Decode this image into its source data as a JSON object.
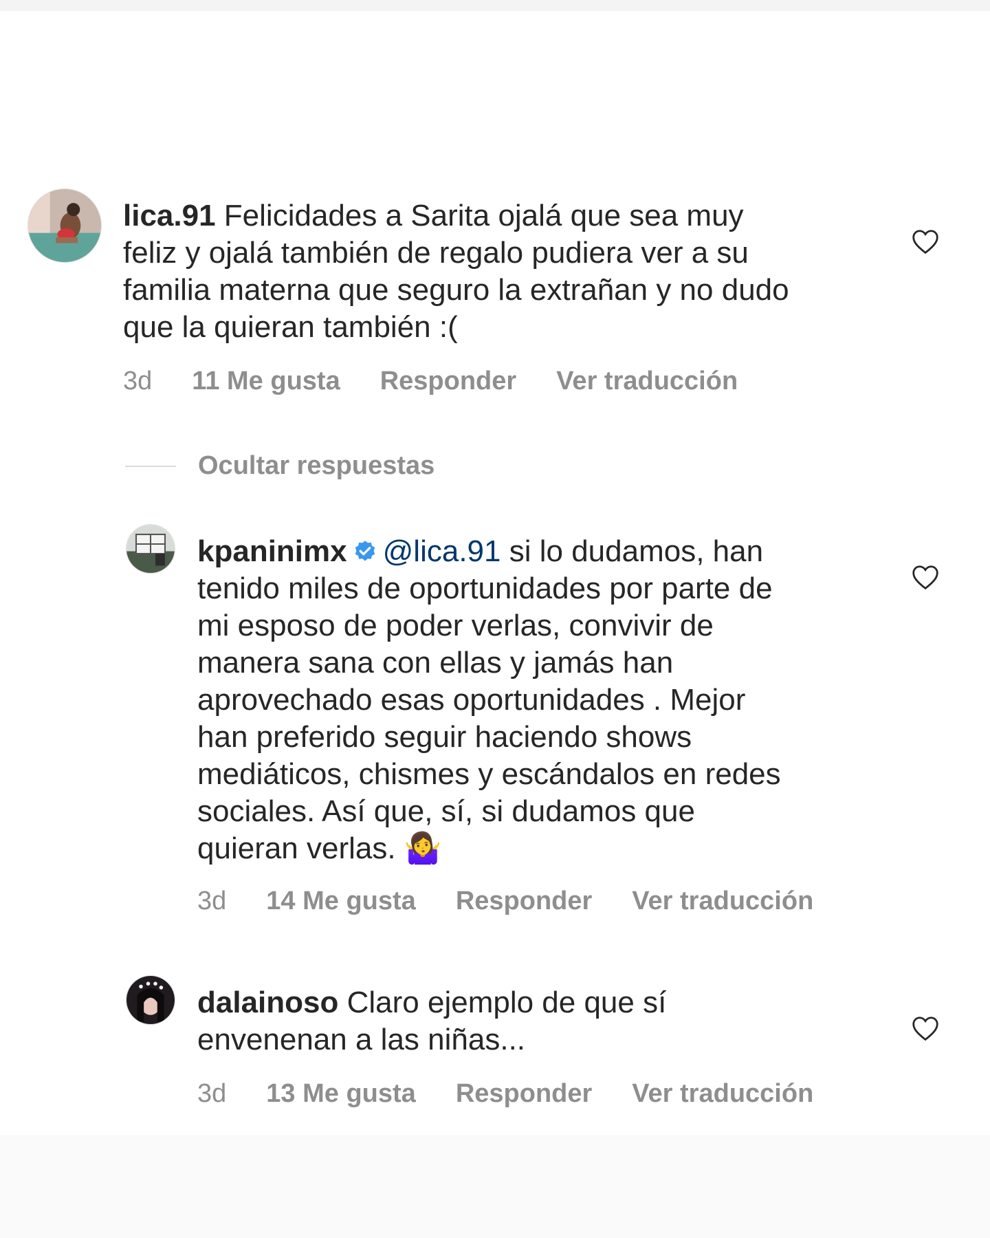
{
  "comments": [
    {
      "username": "lica.91",
      "text": "Felicidades a Sarita ojalá que sea muy\nfeliz y ojalá también de regalo pudiera ver a su\nfamilia materna que seguro la extrañan y no dudo\nque la quieran también :(",
      "time": "3d",
      "likes": "11 Me gusta",
      "reply": "Responder",
      "translate": "Ver traducción"
    },
    {
      "username": "kpaninimx",
      "verified": true,
      "mention": "@lica.91",
      "text": "si lo dudamos, han\ntenido miles de oportunidades por parte de\nmi esposo de poder verlas, convivir de\nmanera sana con ellas  y jamás han\naprovechado esas oportunidades . Mejor\nhan preferido seguir haciendo shows\nmediáticos, chismes y escándalos en redes\nsociales. Así que, sí, si dudamos que\nquieran verlas. 🤷‍♀️",
      "time": "3d",
      "likes": "14 Me gusta",
      "reply": "Responder",
      "translate": "Ver traducción"
    },
    {
      "username": "dalainoso",
      "text": "Claro ejemplo de que sí\nenvenenan a las niñas...",
      "time": "3d",
      "likes": "13 Me gusta",
      "reply": "Responder",
      "translate": "Ver traducción"
    }
  ],
  "hide_replies": "Ocultar respuestas",
  "icons": {
    "like": "heart-outline-icon",
    "verified": "verified-badge-icon"
  },
  "colors": {
    "text": "#262626",
    "meta": "#8e8e8e",
    "mention": "#00376b",
    "verified": "#3897f0"
  }
}
